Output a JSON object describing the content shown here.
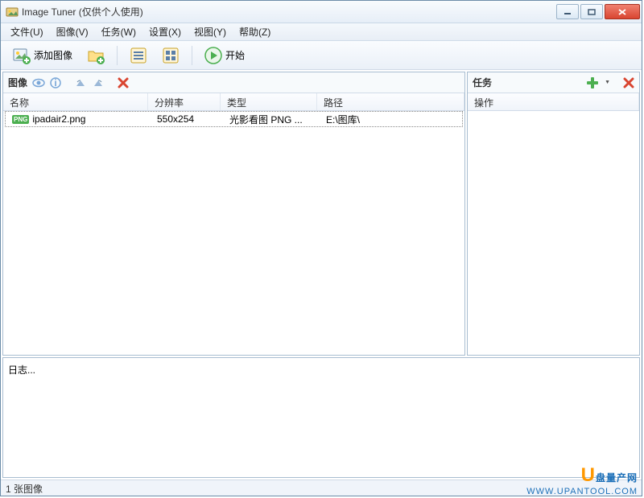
{
  "window": {
    "title": "Image Tuner (仅供个人使用)"
  },
  "menu": {
    "file": "文件(U)",
    "image": "图像(V)",
    "task": "任务(W)",
    "settings": "设置(X)",
    "view": "视图(Y)",
    "help": "帮助(Z)"
  },
  "toolbar": {
    "add_image": "添加图像",
    "start": "开始"
  },
  "left_panel": {
    "title": "图像",
    "columns": {
      "name": "名称",
      "resolution": "分辨率",
      "type": "类型",
      "path": "路径"
    },
    "rows": [
      {
        "filename": "ipadair2.png",
        "resolution": "550x254",
        "type": "光影看图 PNG ...",
        "path": "E:\\图库\\"
      }
    ]
  },
  "right_panel": {
    "title": "任务",
    "columns": {
      "op": "操作"
    }
  },
  "log": {
    "label": "日志..."
  },
  "status": {
    "text": "1 张图像"
  },
  "watermark": {
    "brand": "盘量产网",
    "url": "WWW.UPANTOOL.COM"
  }
}
